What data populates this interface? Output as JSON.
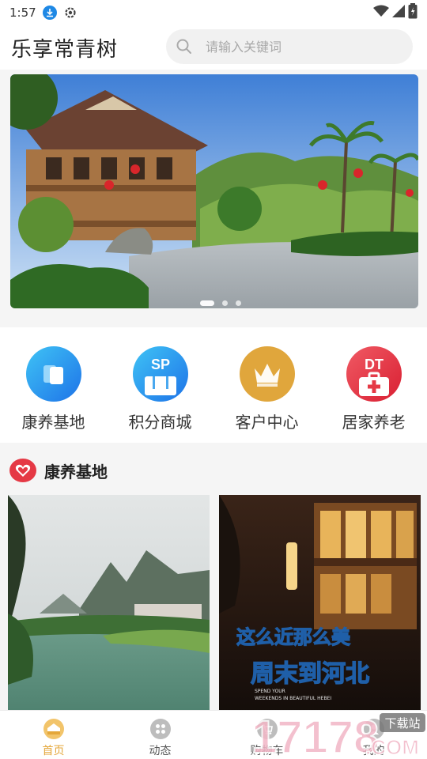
{
  "status_bar": {
    "time": "1:57"
  },
  "header": {
    "title": "乐享常青树",
    "search_placeholder": "请输入关键词"
  },
  "banner": {
    "slide_count": 3,
    "active_index": 0
  },
  "quick_menu": [
    {
      "label": "康养基地",
      "icon": "cards-icon",
      "color": "#1e88e5"
    },
    {
      "label": "积分商城",
      "icon": "shop-icon",
      "badge": "SP",
      "color": "#1e88e5"
    },
    {
      "label": "客户中心",
      "icon": "crown-icon",
      "color": "#e0a63c"
    },
    {
      "label": "居家养老",
      "icon": "medical-kit-icon",
      "badge": "DT",
      "color": "#e53945"
    }
  ],
  "section": {
    "title": "康养基地",
    "icon": "heart-icon",
    "color": "#e53945"
  },
  "cards": [
    {
      "name": "river-mountain-photo"
    },
    {
      "name": "hebei-night-photo",
      "overlay_line1": "这么近那么美",
      "overlay_line2": "周末到河北",
      "overlay_small1": "SPEND YOUR",
      "overlay_small2": "WEEKENDS IN BEAUTIFUL HEBEI"
    }
  ],
  "tab_bar": [
    {
      "label": "首页",
      "icon": "home-icon",
      "active": true
    },
    {
      "label": "动态",
      "icon": "grid-icon",
      "active": false
    },
    {
      "label": "购物车",
      "icon": "cart-icon",
      "active": false
    },
    {
      "label": "我的",
      "icon": "user-icon",
      "active": false
    }
  ],
  "watermark": {
    "main": "17178",
    "suffix": ".COM",
    "tag": "下载站"
  },
  "colors": {
    "accent": "#e4a73a",
    "blue": "#1e88e5",
    "red": "#e53945",
    "gold": "#e0a63c"
  }
}
